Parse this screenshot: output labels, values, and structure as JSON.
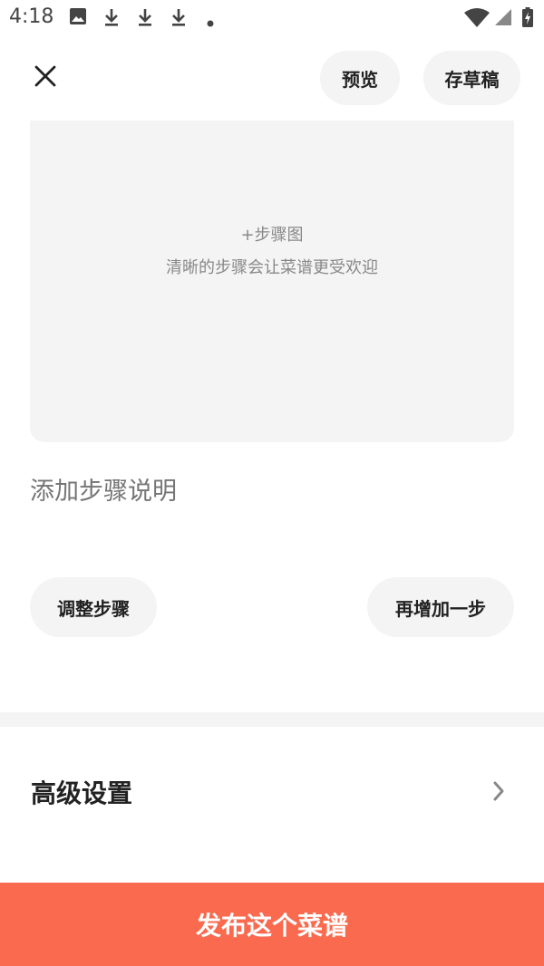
{
  "status_bar": {
    "time": "4:18",
    "icons": [
      "image-icon",
      "download-icon",
      "download-icon",
      "download-icon",
      "dot-icon",
      "wifi-icon",
      "signal-icon",
      "battery-charging-icon"
    ]
  },
  "header": {
    "close_icon": "close-icon",
    "preview_label": "预览",
    "draft_label": "存草稿"
  },
  "step": {
    "photo_add_label": "+步骤图",
    "photo_hint": "清晰的步骤会让菜谱更受欢迎",
    "description_placeholder": "添加步骤说明",
    "adjust_label": "调整步骤",
    "add_step_label": "再增加一步"
  },
  "advanced": {
    "label": "高级设置",
    "chevron_icon": "chevron-right-icon"
  },
  "publish": {
    "label": "发布这个菜谱"
  },
  "colors": {
    "accent": "#f96a4f",
    "pill_bg": "#f4f4f4",
    "text_primary": "#222222",
    "text_hint": "#888888"
  }
}
